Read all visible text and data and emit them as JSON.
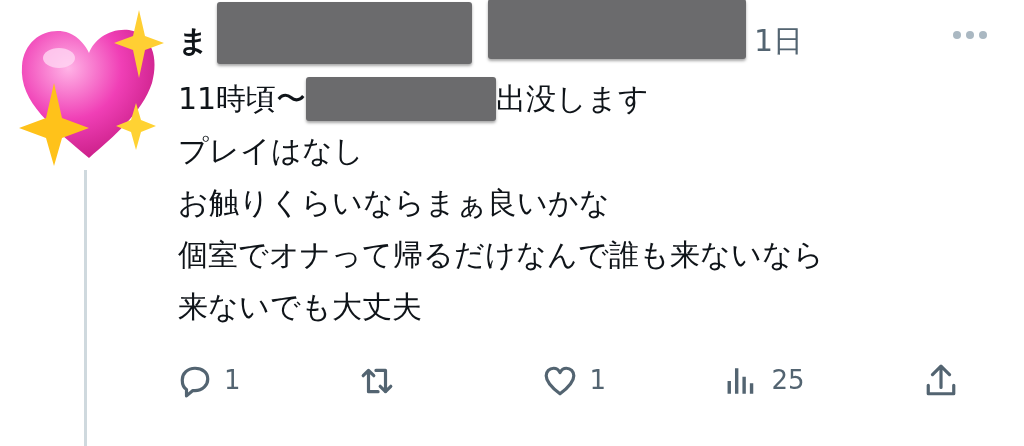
{
  "author": {
    "name": "ま",
    "timestamp": "1日"
  },
  "post": {
    "lines": [
      {
        "segments": [
          {
            "kind": "text",
            "text": "11時頃〜"
          },
          {
            "kind": "redacted"
          },
          {
            "kind": "text",
            "text": "出没します"
          }
        ]
      },
      {
        "segments": [
          {
            "kind": "text",
            "text": "プレイはなし"
          }
        ]
      },
      {
        "segments": [
          {
            "kind": "text",
            "text": "お触りくらいならまぁ良いかな"
          }
        ]
      },
      {
        "segments": [
          {
            "kind": "text",
            "text": "個室でオナって帰るだけなんで誰も来ないなら"
          }
        ]
      },
      {
        "segments": [
          {
            "kind": "text",
            "text": "来ないでも大丈夫"
          }
        ]
      }
    ]
  },
  "actions": [
    {
      "kind": "reply",
      "count": "1"
    },
    {
      "kind": "repost"
    },
    {
      "kind": "like",
      "count": "1"
    },
    {
      "kind": "views",
      "count": "25"
    },
    {
      "kind": "share"
    }
  ]
}
